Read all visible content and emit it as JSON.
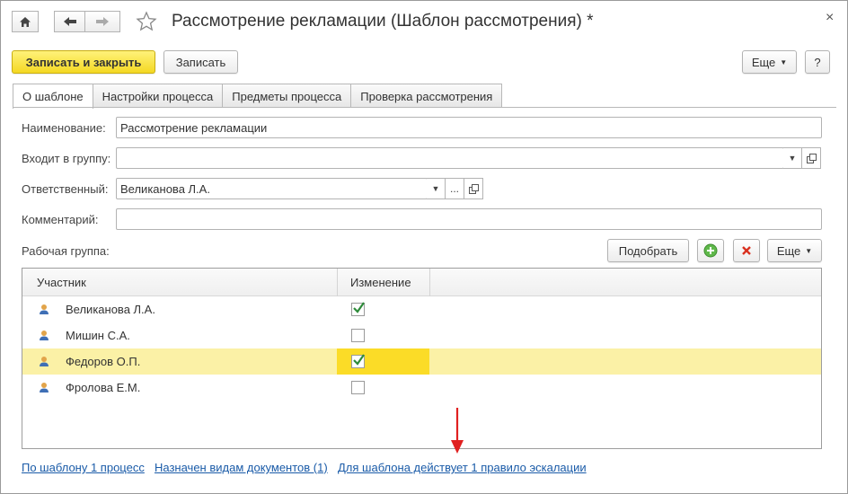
{
  "window": {
    "title": "Рассмотрение рекламации (Шаблон рассмотрения) *",
    "close_glyph": "×"
  },
  "toolbar": {
    "save_close_label": "Записать и закрыть",
    "save_label": "Записать",
    "more_label": "Еще",
    "help_label": "?"
  },
  "tabs": [
    {
      "label": "О шаблоне",
      "active": true
    },
    {
      "label": "Настройки процесса",
      "active": false
    },
    {
      "label": "Предметы процесса",
      "active": false
    },
    {
      "label": "Проверка рассмотрения",
      "active": false
    }
  ],
  "form": {
    "name_label": "Наименование:",
    "name_value": "Рассмотрение рекламации",
    "group_label": "Входит в группу:",
    "group_value": "",
    "responsible_label": "Ответственный:",
    "responsible_value": "Великанова Л.А.",
    "comment_label": "Комментарий:",
    "comment_value": ""
  },
  "workgroup": {
    "label": "Рабочая группа:",
    "pick_label": "Подобрать",
    "more_label": "Еще",
    "columns": [
      "Участник",
      "Изменение"
    ],
    "rows": [
      {
        "name": "Великанова Л.А.",
        "change": true,
        "selected": false
      },
      {
        "name": "Мишин С.А.",
        "change": false,
        "selected": false
      },
      {
        "name": "Федоров О.П.",
        "change": true,
        "selected": true
      },
      {
        "name": "Фролова Е.М.",
        "change": false,
        "selected": false
      }
    ]
  },
  "footer_links": [
    "По шаблону 1 процесс",
    "Назначен видам документов (1)",
    "Для шаблона действует 1 правило эскалации"
  ],
  "colors": {
    "accent_yellow": "#f4d823",
    "selected_row": "#fbf1a6",
    "selected_cell": "#fbdc27",
    "link": "#1a5ba8",
    "check_green": "#2e8b3a",
    "arrow_red": "#e02020"
  }
}
